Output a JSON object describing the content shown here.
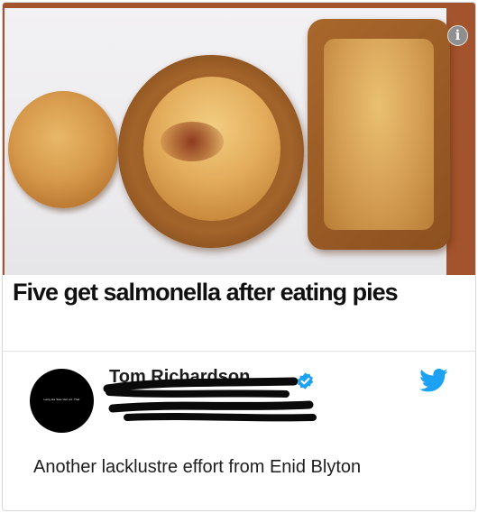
{
  "post": {
    "headline": "Five get salmonella after eating pies",
    "info_icon_glyph": "i"
  },
  "tweet": {
    "display_name_visible": "Tom Richardson",
    "avatar_text": "Lang Ha Swe Hat vnt Yhat",
    "text": "Another lacklustre effort from Enid Blyton",
    "icons": [
      "verified-badge-icon",
      "twitter-bird-icon"
    ]
  },
  "colors": {
    "twitter_blue": "#1da1f2",
    "headline": "#111111",
    "table_wood": "#a4542c"
  }
}
